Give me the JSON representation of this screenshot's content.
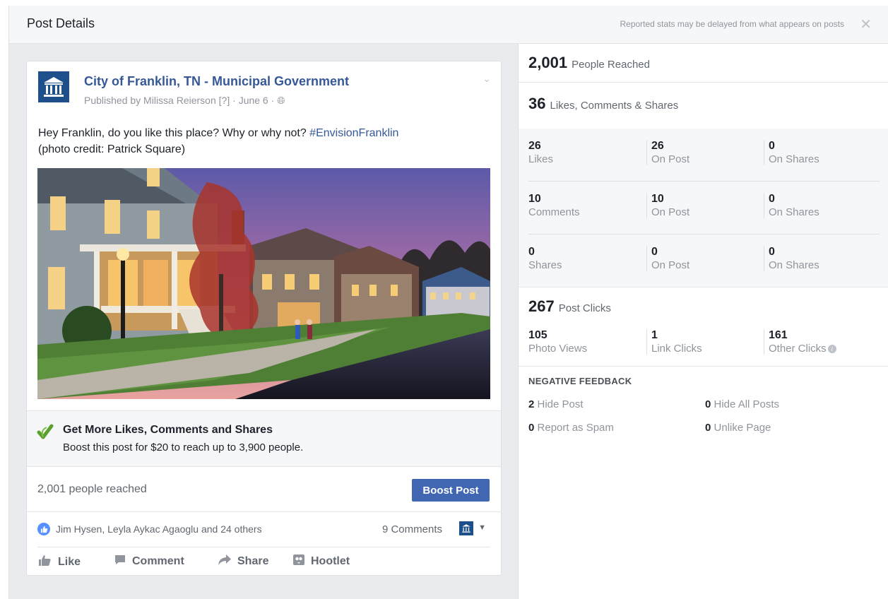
{
  "header": {
    "title": "Post Details",
    "note": "Reported stats may be delayed from what appears on posts",
    "close_icon": "close-icon"
  },
  "post": {
    "page_name": "City of Franklin, TN - Municipal Government",
    "published_prefix": "Published by Milissa Reierson",
    "published_help": "[?]",
    "published_date": "June 6",
    "audience_icon": "globe-icon",
    "message_text": "Hey Franklin, do you like this place? Why or why not? ",
    "hashtag": "#EnvisionFranklin",
    "message_line2": "(photo credit: Patrick Square)"
  },
  "boost_promo": {
    "heading": "Get More Likes, Comments and Shares",
    "subtext": "Boost this post for $20 to reach up to 3,900 people."
  },
  "reach_row": {
    "reach_text": "2,001 people reached",
    "boost_button": "Boost Post"
  },
  "reactions": {
    "reactors": "Jim Hysen, Leyla Aykac Agaoglu and 24 others",
    "comments": "9 Comments"
  },
  "actions": [
    {
      "label": "Like",
      "icon": "thumbs-up-icon"
    },
    {
      "label": "Comment",
      "icon": "comment-icon"
    },
    {
      "label": "Share",
      "icon": "share-arrow-icon"
    },
    {
      "label": "Hootlet",
      "icon": "hootlet-icon"
    }
  ],
  "stats": {
    "reached": {
      "value": "2,001",
      "label": "People Reached"
    },
    "engagement": {
      "value": "36",
      "label": "Likes, Comments & Shares"
    },
    "grid": [
      [
        {
          "value": "26",
          "label": "Likes"
        },
        {
          "value": "26",
          "label": "On Post"
        },
        {
          "value": "0",
          "label": "On Shares"
        }
      ],
      [
        {
          "value": "10",
          "label": "Comments"
        },
        {
          "value": "10",
          "label": "On Post"
        },
        {
          "value": "0",
          "label": "On Shares"
        }
      ],
      [
        {
          "value": "0",
          "label": "Shares"
        },
        {
          "value": "0",
          "label": "On Post"
        },
        {
          "value": "0",
          "label": "On Shares"
        }
      ]
    ],
    "clicks": {
      "value": "267",
      "label": "Post Clicks",
      "items": [
        {
          "value": "105",
          "label": "Photo Views"
        },
        {
          "value": "1",
          "label": "Link Clicks"
        },
        {
          "value": "161",
          "label": "Other Clicks"
        }
      ]
    },
    "negative": {
      "title": "NEGATIVE FEEDBACK",
      "items": [
        {
          "value": "2",
          "label": "Hide Post"
        },
        {
          "value": "0",
          "label": "Hide All Posts"
        },
        {
          "value": "0",
          "label": "Report as Spam"
        },
        {
          "value": "0",
          "label": "Unlike Page"
        }
      ]
    }
  }
}
